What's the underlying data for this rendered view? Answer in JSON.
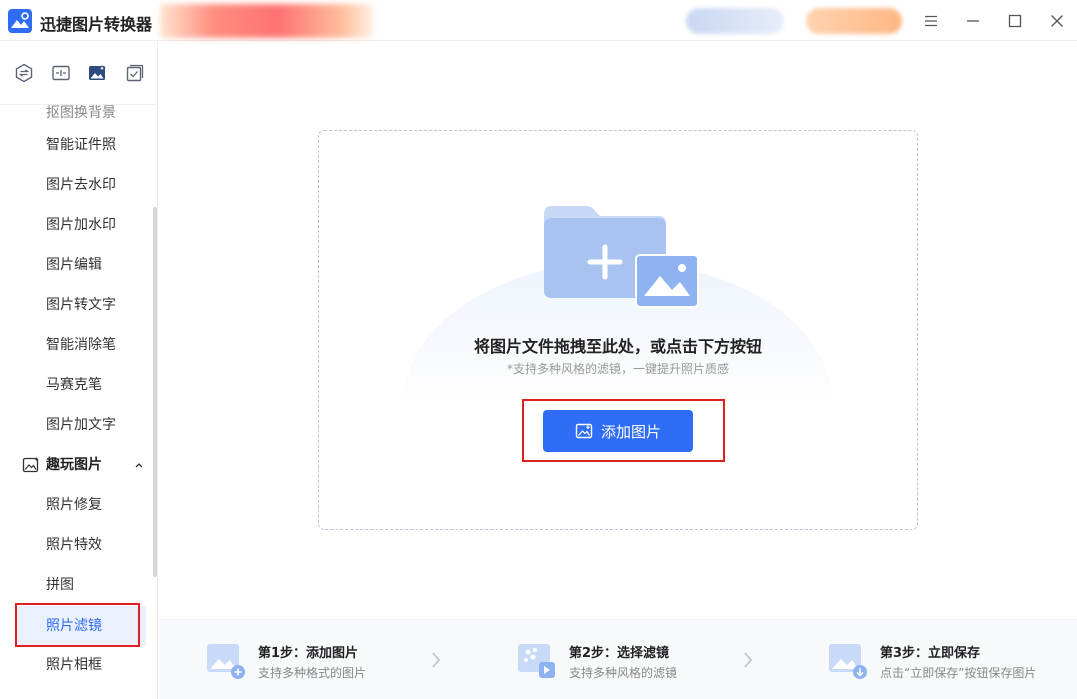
{
  "app": {
    "title": "迅捷图片转换器"
  },
  "sidebar": {
    "tools": [
      {
        "icon": "convert-icon"
      },
      {
        "icon": "compress-icon"
      },
      {
        "icon": "image-edit-icon"
      },
      {
        "icon": "batch-icon"
      }
    ],
    "items_top_partial": "抠图换背景",
    "items": [
      "智能证件照",
      "图片去水印",
      "图片加水印",
      "图片编辑",
      "图片转文字",
      "智能消除笔",
      "马赛克笔",
      "图片加文字"
    ],
    "section": {
      "label": "趣玩图片",
      "icon": "fun-image-icon"
    },
    "section_items": [
      "照片修复",
      "照片特效",
      "拼图",
      "照片滤镜",
      "照片相框"
    ],
    "active_item": "照片滤镜"
  },
  "main": {
    "drop_title": "将图片文件拖拽至此处，或点击下方按钮",
    "drop_subtitle": "*支持多种风格的滤镜，一键提升照片质感",
    "add_button": "添加图片"
  },
  "steps": [
    {
      "title": "第1步：添加图片",
      "desc": "支持多种格式的图片"
    },
    {
      "title": "第2步：选择滤镜",
      "desc": "支持多种风格的滤镜"
    },
    {
      "title": "第3步：立即保存",
      "desc": "点击“立即保存”按钮保存图片"
    }
  ],
  "colors": {
    "accent": "#2f6df6",
    "highlight": "#e02020"
  }
}
